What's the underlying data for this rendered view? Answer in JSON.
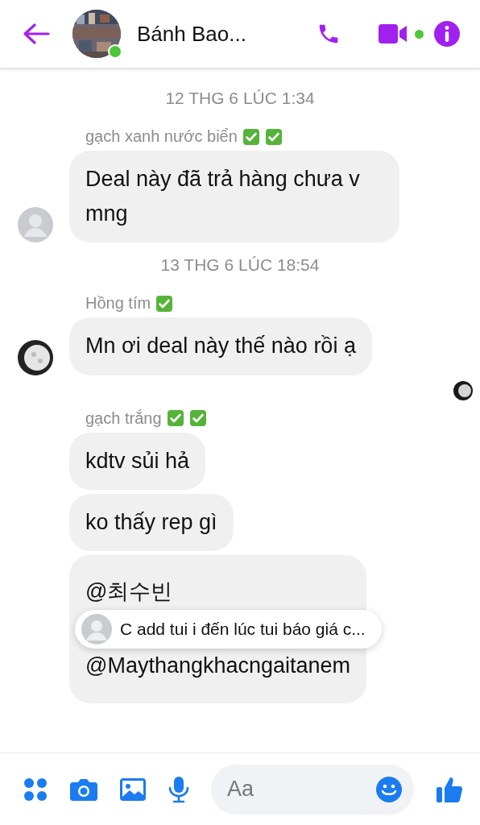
{
  "header": {
    "title": "Bánh Bao...",
    "online": true,
    "video_online": true
  },
  "messages": [
    {
      "kind": "time",
      "text": "12 THG 6 LÚC 1:34"
    },
    {
      "kind": "group",
      "sender": "gạch xanh nước biển",
      "badges": [
        {
          "kind": "check"
        },
        {
          "kind": "check"
        }
      ],
      "avatar": {
        "kind": "picture"
      },
      "bubbles": [
        "Deal này đã trả hàng chưa v mng"
      ]
    },
    {
      "kind": "time",
      "text": "13 THG 6 LÚC 18:54"
    },
    {
      "kind": "group",
      "sender": "Hồng tím",
      "badges": [
        {
          "kind": "check"
        }
      ],
      "avatar": {
        "kind": "picture"
      },
      "bubbles": [
        "Mn ơi deal này thế nào rồi ạ"
      ]
    },
    {
      "kind": "seen"
    },
    {
      "kind": "group",
      "sender": "gạch trắng",
      "badges": [
        {
          "kind": "check"
        },
        {
          "kind": "check"
        }
      ],
      "bubbles": [
        "kdtv sủi hả",
        "ko thấy rep gì",
        "@최수빈\n@Maythangkhacngaitanem"
      ]
    }
  ],
  "reply_preview": {
    "text": "C add tui i đến lúc tui báo giá c..."
  },
  "composer": {
    "placeholder": "Aa"
  }
}
